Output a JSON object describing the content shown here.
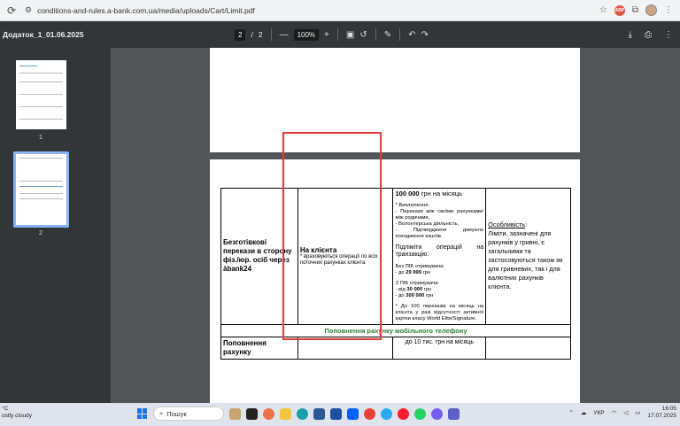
{
  "browser": {
    "url": "conditions-and-rules.a-bank.com.ua/media/uploads/Cart/Limit.pdf",
    "ext_badge": "ABP"
  },
  "pdf_toolbar": {
    "doc_title": "Додаток_1_01.06.2025",
    "current_page": "2",
    "page_sep": "/",
    "total_pages": "2",
    "zoom_minus": "—",
    "zoom": "100%",
    "zoom_plus": "+"
  },
  "sidebar": {
    "thumb1_label": "1",
    "thumb2_label": "2"
  },
  "document": {
    "row1": {
      "col1": "Безготівкові перекази в сторону фіз./юр. осіб через àbank24",
      "col2_title": "На клієнта",
      "col2_sub": "* враховуються операції по всіх поточних рахунках клієнта",
      "col3_limit_amount": "100 000",
      "col3_limit_unit": " грн на місяць",
      "col3_excl_title": "* Виключення:",
      "col3_excl_1": "- Перекази між своїми рахунками/між родичами,",
      "col3_excl_2": "- Волонтерська діяльність,",
      "col3_excl_3": "- Підтверджене джерело походження коштів.",
      "col3_sublimits": "Підліміти операцій на транзакцію:",
      "col3_without_pib": "Без ПІБ отримувача:",
      "col3_without_prefix": "- до ",
      "col3_without_amount": "29 999",
      "col3_without_unit": " грн",
      "col3_with_pib": "З ПІБ отримувача:",
      "col3_with_from_prefix": "- від ",
      "col3_with_from_amount": "30 000",
      "col3_with_from_unit": " грн",
      "col3_with_to_prefix": "- до ",
      "col3_with_to_amount": "300 000",
      "col3_with_to_unit": " грн",
      "col3_note": "* До 100 переказів на місяць на клієнта у разі відсутності активної картки класу World Elite/Signature.",
      "col4_title": "Особливість",
      "col4_colon": ":",
      "col4_text": "Ліміти, зазначені для рахунків у гривні, є загальними та застосовуються також як для гривневих, так і для валютних рахунків клієнта."
    },
    "section_header": "Поповнення рахунку мобільного телефону",
    "row3": {
      "col1": "Поповнення рахунку",
      "col3": "до 10 тис. грн на місяць"
    }
  },
  "taskbar": {
    "weather_temp": "°C",
    "weather_desc": "ostly cloudy",
    "search_placeholder": "Пошук",
    "lang": "УКР",
    "time": "16:05",
    "date": "17.07.2025"
  }
}
